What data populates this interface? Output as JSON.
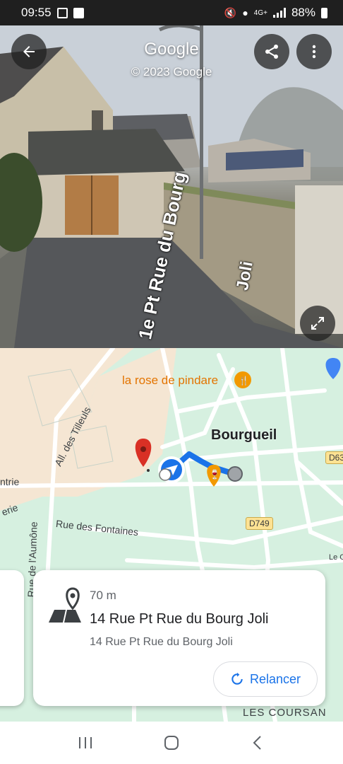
{
  "status_bar": {
    "time": "09:55",
    "network": "4G+",
    "battery": "88%"
  },
  "street_view": {
    "title": "Google",
    "copyright": "© 2023 Google",
    "road_label_1": "1e Pt Rue du Bourg",
    "road_label_2": "Joli",
    "icons": {
      "back": "arrow-left-icon",
      "share": "share-icon",
      "more": "more-vert-icon",
      "expand": "expand-icon"
    }
  },
  "map": {
    "labels": {
      "restaurant": "la rose de pindare",
      "town": "Bourgueil",
      "allee": "All. des Tilleuls",
      "rue_fontaines": "Rue des Fontaines",
      "rue_aumone": "Rue de l'Aumône",
      "entrie": "ntrie",
      "erie": "erie",
      "les_coursan": "LES COURSAN",
      "le_c": "Le C",
      "road_d749": "D749",
      "road_d63": "D63"
    }
  },
  "card": {
    "distance": "70 m",
    "title": "14 Rue Pt Rue du Bourg Joli",
    "subtitle": "14 Rue Pt Rue du Bourg Joli",
    "relancer_label": "Relancer"
  },
  "colors": {
    "accent": "#1a73e8",
    "pin_red": "#d93025",
    "map_green": "#d6f0e0",
    "map_beige": "#f5e6d3",
    "status_bg": "#1f1f1f"
  }
}
